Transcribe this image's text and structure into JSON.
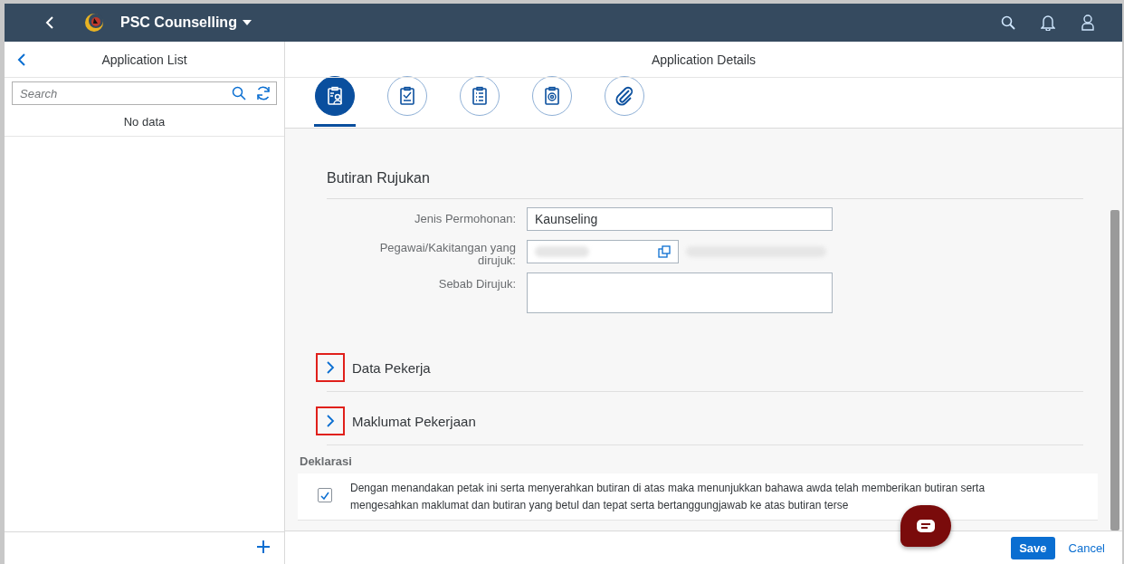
{
  "header": {
    "title": "PSC Counselling"
  },
  "master": {
    "title": "Application List",
    "search": {
      "placeholder": "Search"
    },
    "empty_text": "No data"
  },
  "detail": {
    "title": "Application Details",
    "tabs": [
      {
        "kind": "person",
        "selected": true
      },
      {
        "kind": "check",
        "selected": false
      },
      {
        "kind": "list",
        "selected": false
      },
      {
        "kind": "target",
        "selected": false
      },
      {
        "kind": "clip",
        "selected": false
      }
    ]
  },
  "form": {
    "title": "Butiran Rujukan",
    "fields": [
      {
        "kind": "text",
        "label": "Jenis Permohonan:",
        "value": "Kaunseling"
      },
      {
        "kind": "lookup",
        "label": "Pegawai/Kakitangan yang dirujuk:"
      },
      {
        "kind": "textarea",
        "label": "Sebab Dirujuk:"
      }
    ]
  },
  "sections": [
    {
      "title": "Data Pekerja",
      "expanded": false,
      "highlighted": true
    },
    {
      "title": "Maklumat Pekerjaan",
      "expanded": false,
      "highlighted": true
    }
  ],
  "declaration": {
    "title": "Deklarasi",
    "checked": true,
    "text": "Dengan menandakan petak ini serta menyerahkan butiran di atas maka menunjukkan bahawa awda telah memberikan butiran serta mengesahkan maklumat dan butiran yang betul dan tepat serta bertanggungjawab ke atas butiran terse"
  },
  "footer": {
    "buttons": [
      {
        "label": "Save",
        "kind": "primary"
      },
      {
        "label": "Cancel",
        "kind": "transparent"
      }
    ]
  }
}
